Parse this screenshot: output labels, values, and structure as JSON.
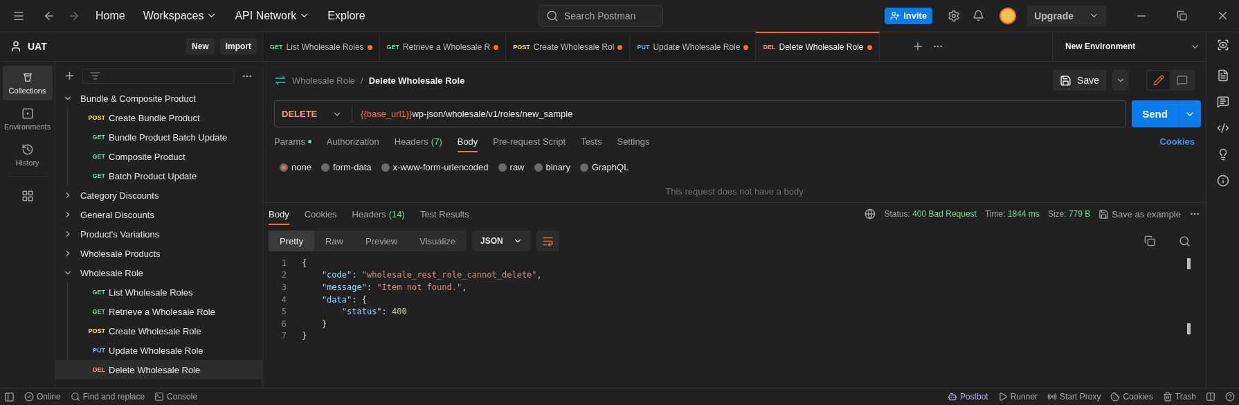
{
  "topbar": {
    "nav": [
      {
        "label": "Home",
        "dropdown": false
      },
      {
        "label": "Workspaces",
        "dropdown": true
      },
      {
        "label": "API Network",
        "dropdown": true
      },
      {
        "label": "Explore",
        "dropdown": false
      }
    ],
    "search": {
      "placeholder": "Search Postman"
    },
    "invite": "Invite",
    "upgrade": "Upgrade"
  },
  "workspace": {
    "name": "UAT",
    "new": "New",
    "import": "Import"
  },
  "rail": [
    {
      "kind": "collections",
      "label": "Collections",
      "selected": true
    },
    {
      "kind": "environments",
      "label": "Environments",
      "selected": false
    },
    {
      "kind": "history",
      "label": "History",
      "selected": false
    }
  ],
  "tree": [
    {
      "kind": "folder",
      "label": "Bundle & Composite Product",
      "expanded": true,
      "children": [
        {
          "kind": "request",
          "method": "POST",
          "color": "#ffe47e",
          "label": "Create Bundle Product",
          "selected": false
        },
        {
          "kind": "request",
          "method": "GET",
          "color": "#6bdd9a",
          "label": "Bundle Product Batch Update",
          "selected": false
        },
        {
          "kind": "request",
          "method": "GET",
          "color": "#6bdd9a",
          "label": "Composite Product",
          "selected": false
        },
        {
          "kind": "request",
          "method": "GET",
          "color": "#6bdd9a",
          "label": "Batch Product Update",
          "selected": false
        }
      ]
    },
    {
      "kind": "folder",
      "label": "Category Discounts",
      "expanded": false
    },
    {
      "kind": "folder",
      "label": "General Discounts",
      "expanded": false
    },
    {
      "kind": "folder",
      "label": "Product's Variations",
      "expanded": false
    },
    {
      "kind": "folder",
      "label": "Wholesale Products",
      "expanded": false
    },
    {
      "kind": "folder",
      "label": "Wholesale Role",
      "expanded": true,
      "children": [
        {
          "kind": "request",
          "method": "GET",
          "color": "#6bdd9a",
          "label": "List Wholesale Roles",
          "selected": false
        },
        {
          "kind": "request",
          "method": "GET",
          "color": "#6bdd9a",
          "label": "Retrieve a Wholesale Role",
          "selected": false
        },
        {
          "kind": "request",
          "method": "POST",
          "color": "#ffe47e",
          "label": "Create Wholesale Role",
          "selected": false
        },
        {
          "kind": "request",
          "method": "PUT",
          "color": "#74aef6",
          "label": "Update Wholesale Role",
          "selected": false
        },
        {
          "kind": "request",
          "method": "DEL",
          "color": "#f79a8e",
          "label": "Delete Wholesale Role",
          "selected": true
        }
      ]
    }
  ],
  "tabs": [
    {
      "method": "GET",
      "color": "#6bdd9a",
      "label": "List Wholesale Roles",
      "unsaved": true,
      "selected": false
    },
    {
      "method": "GET",
      "color": "#6bdd9a",
      "label": "Retrieve a Wholesale R",
      "unsaved": true,
      "selected": false
    },
    {
      "method": "POST",
      "color": "#ffe47e",
      "label": "Create Wholesale Rol",
      "unsaved": true,
      "selected": false
    },
    {
      "method": "PUT",
      "color": "#74aef6",
      "label": "Update Wholesale Role",
      "unsaved": true,
      "selected": false
    },
    {
      "method": "DEL",
      "color": "#f79a8e",
      "label": "Delete Wholesale Role",
      "unsaved": true,
      "selected": true
    }
  ],
  "environment": "New Environment",
  "breadcrumb": {
    "parent": "Wholesale Role",
    "separator": "/",
    "current": "Delete Wholesale Role"
  },
  "save": "Save",
  "request": {
    "method": "DELETE",
    "url_variable": "{{base_url1}}",
    "url_path": "wp-json/wholesale/v1/roles/new_sample",
    "send": "Send"
  },
  "request_tabs": [
    {
      "label": "Params",
      "modified": true,
      "selected": false
    },
    {
      "label": "Authorization",
      "modified": false,
      "selected": false
    },
    {
      "label": "Headers",
      "count": "(7)",
      "modified": false,
      "selected": false
    },
    {
      "label": "Body",
      "modified": false,
      "selected": true
    },
    {
      "label": "Pre-request Script",
      "modified": false,
      "selected": false
    },
    {
      "label": "Tests",
      "modified": false,
      "selected": false
    },
    {
      "label": "Settings",
      "modified": false,
      "selected": false
    }
  ],
  "cookies_link": "Cookies",
  "body_types": [
    {
      "label": "none",
      "selected": true
    },
    {
      "label": "form-data",
      "selected": false
    },
    {
      "label": "x-www-form-urlencoded",
      "selected": false
    },
    {
      "label": "raw",
      "selected": false
    },
    {
      "label": "binary",
      "selected": false
    },
    {
      "label": "GraphQL",
      "selected": false
    }
  ],
  "body_message": "This request does not have a body",
  "response_tabs": [
    {
      "label": "Body",
      "selected": true
    },
    {
      "label": "Cookies",
      "selected": false
    },
    {
      "label": "Headers",
      "count": "(14)",
      "selected": false
    },
    {
      "label": "Test Results",
      "selected": false
    }
  ],
  "response_meta": {
    "status_label": "Status:",
    "status": "400 Bad Request",
    "time_label": "Time:",
    "time": "1844 ms",
    "size_label": "Size:",
    "size": "779 B",
    "save_example": "Save as example"
  },
  "view_modes": [
    {
      "label": "Pretty",
      "selected": true
    },
    {
      "label": "Raw",
      "selected": false
    },
    {
      "label": "Preview",
      "selected": false
    },
    {
      "label": "Visualize",
      "selected": false
    }
  ],
  "format": "JSON",
  "code_lines": [
    {
      "number": "1",
      "tokens": [
        {
          "kind": "punct",
          "text": "{"
        }
      ]
    },
    {
      "number": "2",
      "tokens": [
        {
          "kind": "key",
          "text": "    \"code\""
        },
        {
          "kind": "punct",
          "text": ": "
        },
        {
          "kind": "string",
          "text": "\"wholesale_rest_role_cannot_delete\""
        },
        {
          "kind": "punct",
          "text": ","
        }
      ]
    },
    {
      "number": "3",
      "tokens": [
        {
          "kind": "key",
          "text": "    \"message\""
        },
        {
          "kind": "punct",
          "text": ": "
        },
        {
          "kind": "string",
          "text": "\"Item not found.\""
        },
        {
          "kind": "punct",
          "text": ","
        }
      ]
    },
    {
      "number": "4",
      "tokens": [
        {
          "kind": "key",
          "text": "    \"data\""
        },
        {
          "kind": "punct",
          "text": ": {"
        }
      ]
    },
    {
      "number": "5",
      "tokens": [
        {
          "kind": "key",
          "text": "        \"status\""
        },
        {
          "kind": "punct",
          "text": ": "
        },
        {
          "kind": "number",
          "text": "400"
        }
      ]
    },
    {
      "number": "6",
      "tokens": [
        {
          "kind": "punct",
          "text": "    }"
        }
      ]
    },
    {
      "number": "7",
      "tokens": [
        {
          "kind": "punct",
          "text": "}"
        }
      ]
    }
  ],
  "status_bar": {
    "left": [
      {
        "kind": "online",
        "label": "Online"
      },
      {
        "kind": "find",
        "label": "Find and replace"
      },
      {
        "kind": "console",
        "label": "Console"
      }
    ],
    "right": [
      {
        "kind": "postbot",
        "label": "Postbot"
      },
      {
        "kind": "runner",
        "label": "Runner"
      },
      {
        "kind": "proxy",
        "label": "Start Proxy"
      },
      {
        "kind": "cookies",
        "label": "Cookies"
      },
      {
        "kind": "trash",
        "label": "Trash"
      }
    ]
  }
}
